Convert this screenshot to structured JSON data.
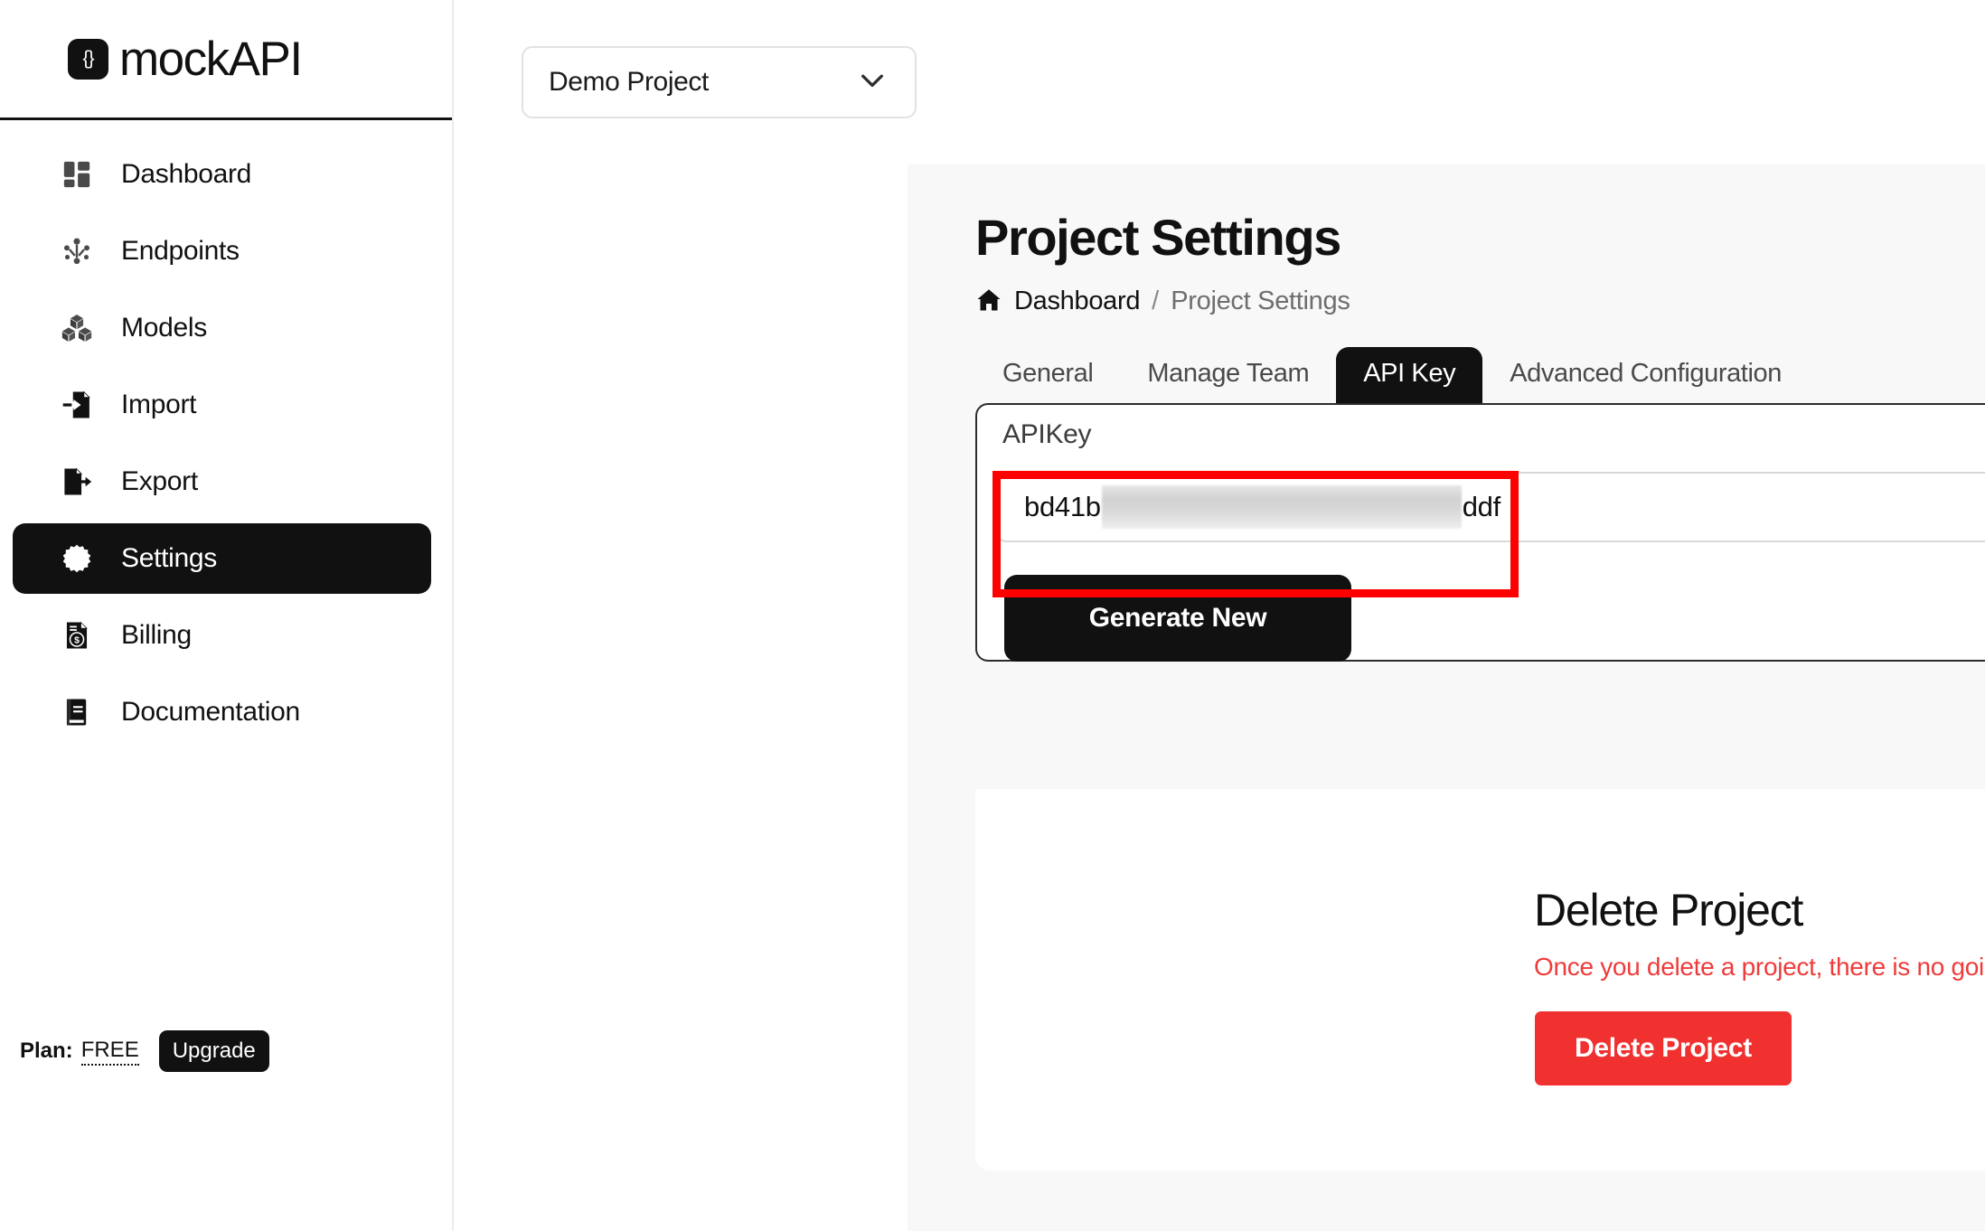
{
  "brand": {
    "logo_mark": "{}",
    "name": "mockAPI"
  },
  "sidebar": {
    "items": [
      {
        "label": "Dashboard",
        "icon": "dashboard-icon",
        "active": false
      },
      {
        "label": "Endpoints",
        "icon": "endpoints-icon",
        "active": false
      },
      {
        "label": "Models",
        "icon": "models-icon",
        "active": false
      },
      {
        "label": "Import",
        "icon": "import-icon",
        "active": false
      },
      {
        "label": "Export",
        "icon": "export-icon",
        "active": false
      },
      {
        "label": "Settings",
        "icon": "settings-gear-api-icon",
        "active": true
      },
      {
        "label": "Billing",
        "icon": "billing-invoice-icon",
        "active": false
      },
      {
        "label": "Documentation",
        "icon": "documentation-book-icon",
        "active": false
      }
    ],
    "plan": {
      "label": "Plan:",
      "value": "FREE",
      "upgrade_label": "Upgrade"
    }
  },
  "topbar": {
    "project_selector": {
      "value": "Demo Project",
      "icon": "chevron-down-icon"
    }
  },
  "page": {
    "title": "Project Settings",
    "breadcrumb": {
      "home_icon": "home-icon",
      "home": "Dashboard",
      "separator": "/",
      "current": "Project Settings"
    },
    "tabs": [
      {
        "label": "General",
        "active": false
      },
      {
        "label": "Manage Team",
        "active": false
      },
      {
        "label": "API Key",
        "active": true
      },
      {
        "label": "Advanced Configuration",
        "active": false
      }
    ]
  },
  "api_key_panel": {
    "label": "APIKey",
    "key_prefix": "bd41b",
    "key_suffix": "ddf",
    "key_masked": true,
    "copy_icon": "copy-icon",
    "generate_label": "Generate New"
  },
  "danger_zone": {
    "title": "Delete Project",
    "warning": "Once you delete a project, there is no going back.",
    "button_label": "Delete Project"
  },
  "annotation": {
    "type": "red-highlight-box",
    "color": "#ff0000"
  },
  "colors": {
    "accent_dark": "#111111",
    "danger": "#f0312f",
    "danger_text": "#ef3b3b",
    "page_bg": "#f8f8f8",
    "border": "#e2e2e2"
  }
}
